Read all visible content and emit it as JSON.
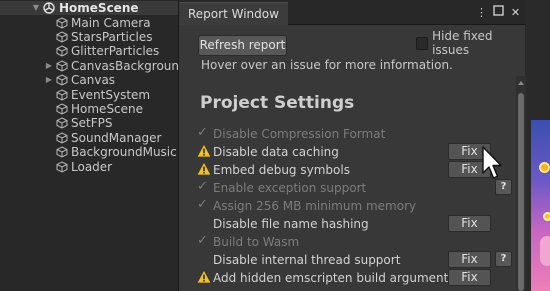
{
  "hierarchy": {
    "scene_name": "HomeScene",
    "items": [
      {
        "label": "Main Camera"
      },
      {
        "label": "StarsParticles"
      },
      {
        "label": "GlitterParticles"
      },
      {
        "label": "CanvasBackground"
      },
      {
        "label": "Canvas"
      },
      {
        "label": "EventSystem"
      },
      {
        "label": "HomeScene"
      },
      {
        "label": "SetFPS"
      },
      {
        "label": "SoundManager"
      },
      {
        "label": "BackgroundMusic"
      },
      {
        "label": "Loader"
      }
    ]
  },
  "report_window": {
    "title": "Report Window",
    "refresh_label": "Refresh report",
    "hide_fixed_label": "Hide fixed issues",
    "hover_hint": "Hover over an issue for more information.",
    "section_title": "Project Settings",
    "fix_label": "Fix",
    "help_label": "?",
    "issues": [
      {
        "label": "Disable Compression Format",
        "state": "fixed"
      },
      {
        "label": "Disable data caching",
        "state": "warning"
      },
      {
        "label": "Embed debug symbols",
        "state": "warning"
      },
      {
        "label": "Enable exception support",
        "state": "fixed"
      },
      {
        "label": "Assign 256 MB minimum memory",
        "state": "fixed"
      },
      {
        "label": "Disable file name hashing",
        "state": "open"
      },
      {
        "label": "Build to Wasm",
        "state": "fixed"
      },
      {
        "label": "Disable internal thread support",
        "state": "open"
      },
      {
        "label": "Add hidden emscripten build arguments",
        "state": "warning"
      }
    ]
  },
  "icons": {
    "more": "kebab-menu-icon",
    "maximize": "maximize-icon",
    "close": "close-icon",
    "warning": "warning-icon",
    "check": "checkmark-icon",
    "game_object": "cube-icon",
    "scene": "unity-scene-icon"
  },
  "colors": {
    "warning": "#f4c21f",
    "panel": "#383838",
    "button": "#545454"
  }
}
